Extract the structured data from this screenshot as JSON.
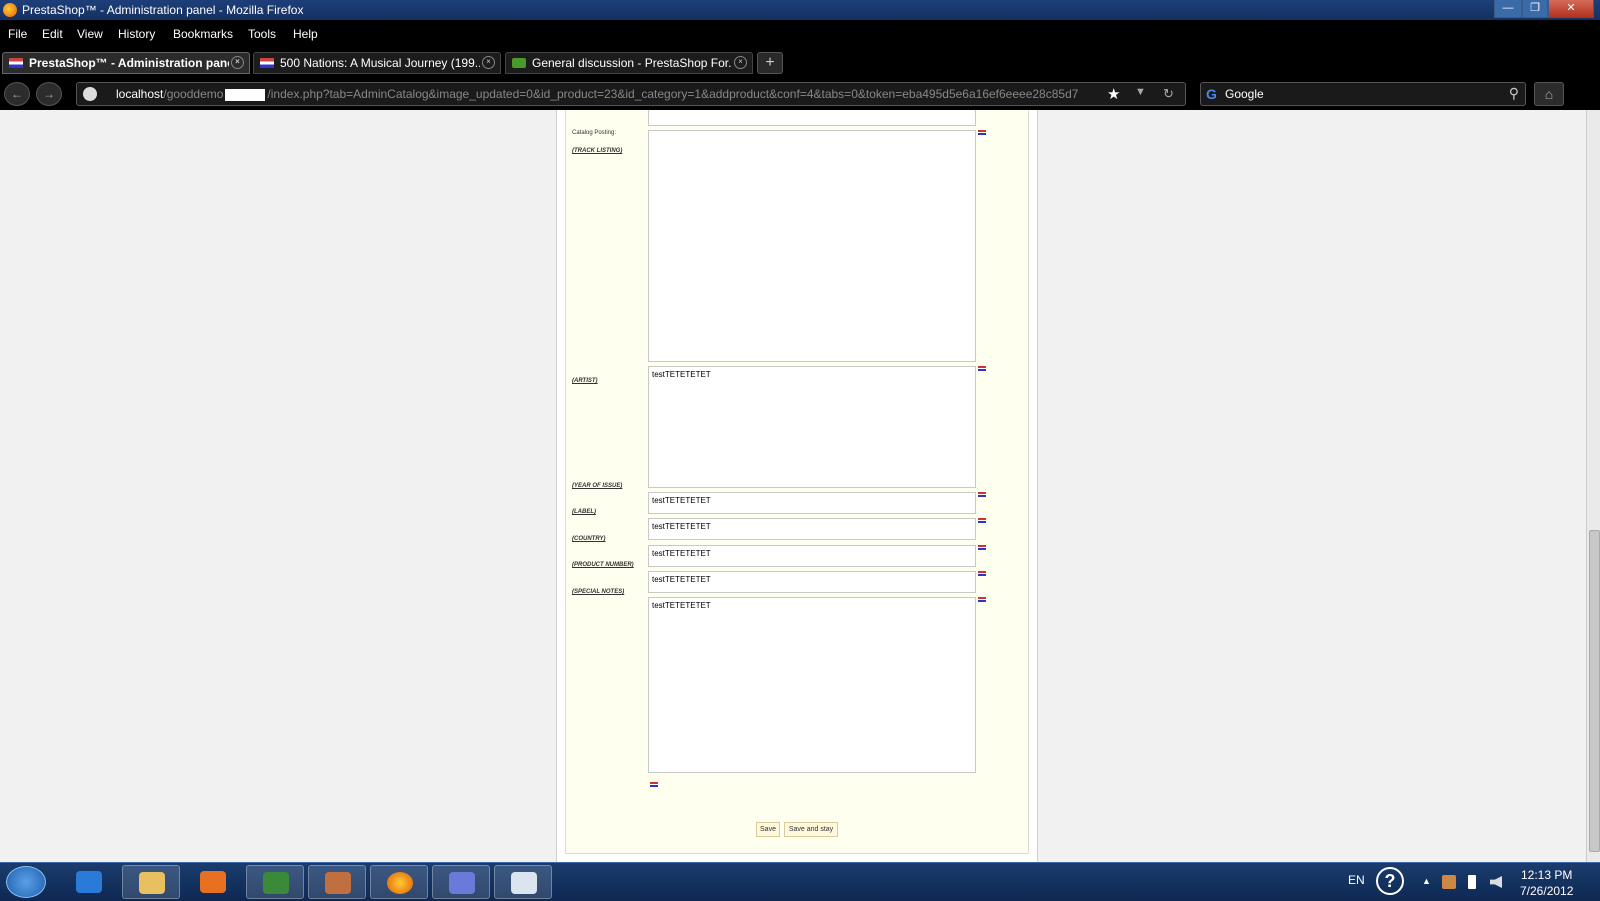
{
  "window": {
    "title": "PrestaShop™ - Administration panel - Mozilla Firefox",
    "min": "—",
    "max": "❐",
    "close": "✕"
  },
  "menu": [
    "File",
    "Edit",
    "View",
    "History",
    "Bookmarks",
    "Tools",
    "Help"
  ],
  "tabs": [
    {
      "label": "PrestaShop™ - Administration panel",
      "active": true
    },
    {
      "label": "500 Nations: A Musical Journey (199...",
      "active": false
    },
    {
      "label": "General discussion - PrestaShop For...",
      "active": false
    }
  ],
  "tab_close": "×",
  "new_tab": "+",
  "nav": {
    "back": "←",
    "forward": "→",
    "url_host": "localhost",
    "url_path_a": "/gooddemo",
    "url_path_b": "/index.php?tab=AdminCatalog&image_updated=0&id_product=23&id_category=1&addproduct&conf=4&tabs=0&token=eba495d5e6a16ef6eeee28c85d7",
    "star": "★",
    "drop": "▼",
    "reload": "↻",
    "search": "Google",
    "search_g": "G",
    "magnifier": "⚲",
    "home": "⌂"
  },
  "form": {
    "catalog_posting": "Catalog Posting:",
    "track_listing_label": "(TRACK LISTING)",
    "artist_label": "(ARTIST)",
    "artist_value": "testTETETETET",
    "year_label": "(YEAR OF ISSUE)",
    "year_value": "testTETETETET",
    "label_label": "(LABEL)",
    "label_value": "testTETETETET",
    "country_label": "(COUNTRY)",
    "country_value": "testTETETETET",
    "product_number_label": "(PRODUCT NUMBER)",
    "product_number_value": "testTETETETET",
    "special_notes_label": "(SPECIAL NOTES)",
    "special_notes_value": "testTETETETET",
    "save": "Save",
    "save_and_stay": "Save and stay"
  },
  "taskbar": {
    "lang": "EN",
    "help": "?",
    "tray_up": "▲",
    "time": "12:13 PM",
    "date": "7/26/2012"
  },
  "colors": {
    "accent": "#1d3f7a",
    "form_bg": "#fffff0"
  }
}
